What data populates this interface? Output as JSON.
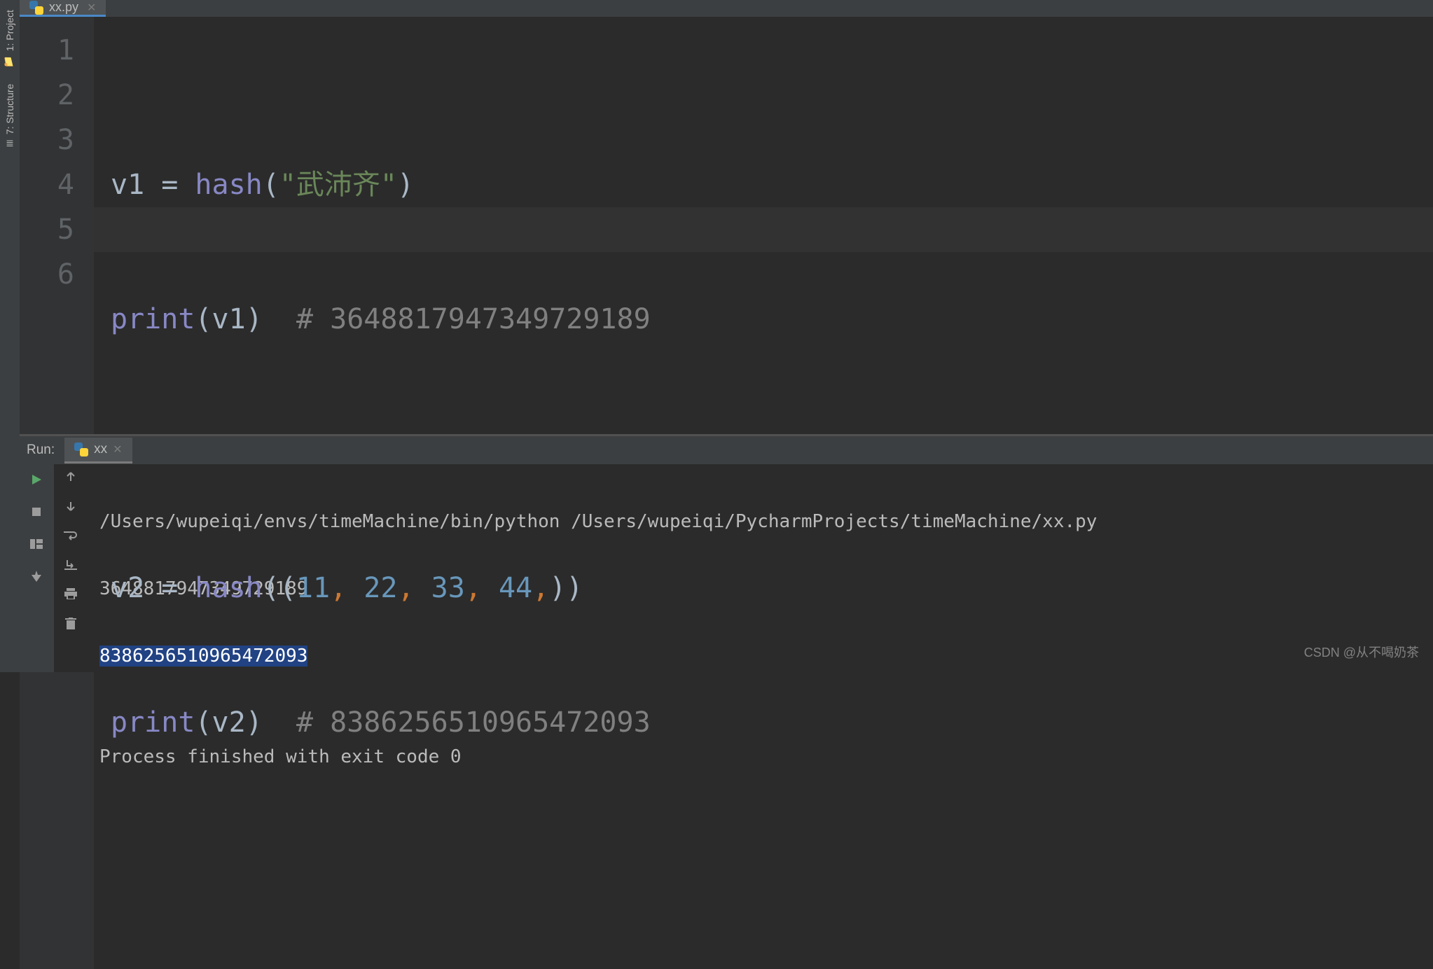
{
  "left_tools": {
    "project": "1: Project",
    "structure": "7: Structure"
  },
  "tab": {
    "filename": "xx.py"
  },
  "editor": {
    "lines": [
      "1",
      "2",
      "3",
      "4",
      "5",
      "6"
    ],
    "l1": {
      "v": "v1 ",
      "eq": "= ",
      "fn": "hash",
      "p1": "(",
      "s": "\"武沛齐\"",
      "p2": ")"
    },
    "l2": {
      "fn": "print",
      "p1": "(",
      "arg": "v1",
      "p2": ")",
      "pad": "  ",
      "c": "# 3648817947349729189"
    },
    "l4": {
      "v": "v2 ",
      "eq": "= ",
      "fn": "hash",
      "p1": "((",
      "n1": "11",
      "c1": ", ",
      "n2": "22",
      "c2": ", ",
      "n3": "33",
      "c3": ", ",
      "n4": "44",
      "c4": ",",
      "p2": "))"
    },
    "l5": {
      "fn": "print",
      "p1": "(",
      "arg": "v2",
      "p2": ")",
      "pad": "  ",
      "c": "# 8386256510965472093"
    }
  },
  "run": {
    "label": "Run:",
    "tab": "xx",
    "cmd": "/Users/wupeiqi/envs/timeMachine/bin/python /Users/wupeiqi/PycharmProjects/timeMachine/xx.py",
    "out1": "3648817947349729189",
    "out2": "8386256510965472093",
    "blank": "",
    "exit": "Process finished with exit code 0"
  },
  "watermark": "CSDN @从不喝奶茶"
}
